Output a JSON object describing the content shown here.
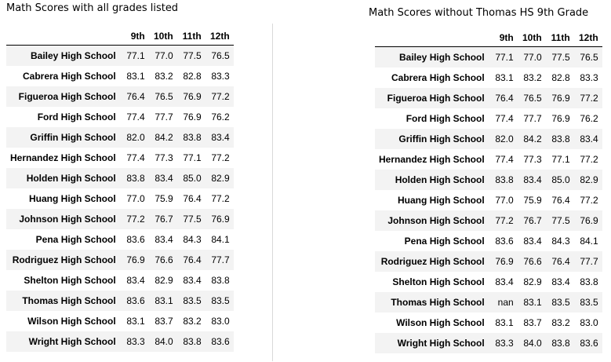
{
  "left": {
    "caption": "Math Scores with all grades listed",
    "columns": [
      "",
      "9th",
      "10th",
      "11th",
      "12th"
    ],
    "rows": [
      {
        "school": "Bailey High School",
        "g9": "77.1",
        "g10": "77.0",
        "g11": "77.5",
        "g12": "76.5"
      },
      {
        "school": "Cabrera High School",
        "g9": "83.1",
        "g10": "83.2",
        "g11": "82.8",
        "g12": "83.3"
      },
      {
        "school": "Figueroa High School",
        "g9": "76.4",
        "g10": "76.5",
        "g11": "76.9",
        "g12": "77.2"
      },
      {
        "school": "Ford High School",
        "g9": "77.4",
        "g10": "77.7",
        "g11": "76.9",
        "g12": "76.2"
      },
      {
        "school": "Griffin High School",
        "g9": "82.0",
        "g10": "84.2",
        "g11": "83.8",
        "g12": "83.4"
      },
      {
        "school": "Hernandez High School",
        "g9": "77.4",
        "g10": "77.3",
        "g11": "77.1",
        "g12": "77.2"
      },
      {
        "school": "Holden High School",
        "g9": "83.8",
        "g10": "83.4",
        "g11": "85.0",
        "g12": "82.9"
      },
      {
        "school": "Huang High School",
        "g9": "77.0",
        "g10": "75.9",
        "g11": "76.4",
        "g12": "77.2"
      },
      {
        "school": "Johnson High School",
        "g9": "77.2",
        "g10": "76.7",
        "g11": "77.5",
        "g12": "76.9"
      },
      {
        "school": "Pena High School",
        "g9": "83.6",
        "g10": "83.4",
        "g11": "84.3",
        "g12": "84.1"
      },
      {
        "school": "Rodriguez High School",
        "g9": "76.9",
        "g10": "76.6",
        "g11": "76.4",
        "g12": "77.7"
      },
      {
        "school": "Shelton High School",
        "g9": "83.4",
        "g10": "82.9",
        "g11": "83.4",
        "g12": "83.8"
      },
      {
        "school": "Thomas High School",
        "g9": "83.6",
        "g10": "83.1",
        "g11": "83.5",
        "g12": "83.5"
      },
      {
        "school": "Wilson High School",
        "g9": "83.1",
        "g10": "83.7",
        "g11": "83.2",
        "g12": "83.0"
      },
      {
        "school": "Wright High School",
        "g9": "83.3",
        "g10": "84.0",
        "g11": "83.8",
        "g12": "83.6"
      }
    ]
  },
  "right": {
    "caption": "Math Scores without Thomas HS 9th Grade",
    "columns": [
      "",
      "9th",
      "10th",
      "11th",
      "12th"
    ],
    "rows": [
      {
        "school": "Bailey High School",
        "g9": "77.1",
        "g10": "77.0",
        "g11": "77.5",
        "g12": "76.5"
      },
      {
        "school": "Cabrera High School",
        "g9": "83.1",
        "g10": "83.2",
        "g11": "82.8",
        "g12": "83.3"
      },
      {
        "school": "Figueroa High School",
        "g9": "76.4",
        "g10": "76.5",
        "g11": "76.9",
        "g12": "77.2"
      },
      {
        "school": "Ford High School",
        "g9": "77.4",
        "g10": "77.7",
        "g11": "76.9",
        "g12": "76.2"
      },
      {
        "school": "Griffin High School",
        "g9": "82.0",
        "g10": "84.2",
        "g11": "83.8",
        "g12": "83.4"
      },
      {
        "school": "Hernandez High School",
        "g9": "77.4",
        "g10": "77.3",
        "g11": "77.1",
        "g12": "77.2"
      },
      {
        "school": "Holden High School",
        "g9": "83.8",
        "g10": "83.4",
        "g11": "85.0",
        "g12": "82.9"
      },
      {
        "school": "Huang High School",
        "g9": "77.0",
        "g10": "75.9",
        "g11": "76.4",
        "g12": "77.2"
      },
      {
        "school": "Johnson High School",
        "g9": "77.2",
        "g10": "76.7",
        "g11": "77.5",
        "g12": "76.9"
      },
      {
        "school": "Pena High School",
        "g9": "83.6",
        "g10": "83.4",
        "g11": "84.3",
        "g12": "84.1"
      },
      {
        "school": "Rodriguez High School",
        "g9": "76.9",
        "g10": "76.6",
        "g11": "76.4",
        "g12": "77.7"
      },
      {
        "school": "Shelton High School",
        "g9": "83.4",
        "g10": "82.9",
        "g11": "83.4",
        "g12": "83.8"
      },
      {
        "school": "Thomas High School",
        "g9": "nan",
        "g10": "83.1",
        "g11": "83.5",
        "g12": "83.5"
      },
      {
        "school": "Wilson High School",
        "g9": "83.1",
        "g10": "83.7",
        "g11": "83.2",
        "g12": "83.0"
      },
      {
        "school": "Wright High School",
        "g9": "83.3",
        "g10": "84.0",
        "g11": "83.8",
        "g12": "83.6"
      }
    ]
  }
}
